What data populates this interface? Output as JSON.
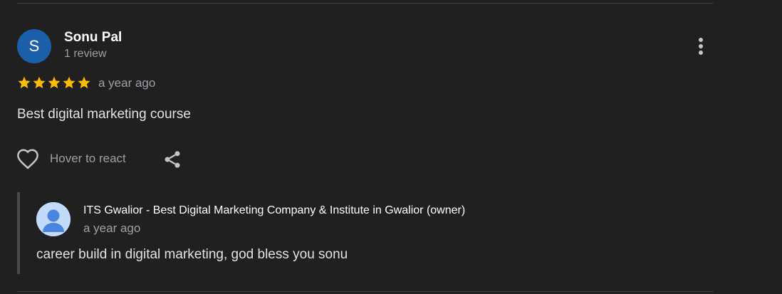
{
  "review": {
    "avatar_initial": "S",
    "avatar_color": "#1a5fa8",
    "reviewer_name": "Sonu Pal",
    "reviewer_meta": "1 review",
    "rating": 5,
    "star_color": "#fbbc04",
    "time": "a year ago",
    "text": "Best digital marketing course",
    "react_label": "Hover to react"
  },
  "owner_reply": {
    "owner_name": "ITS Gwalior - Best Digital Marketing Company & Institute in Gwalior (owner)",
    "time": "a year ago",
    "text": "career build in digital marketing, god bless you sonu"
  },
  "icons": {
    "more": "more-vert-icon",
    "heart": "heart-outline-icon",
    "share": "share-icon",
    "star": "star-icon",
    "owner_avatar": "default-person-avatar"
  }
}
